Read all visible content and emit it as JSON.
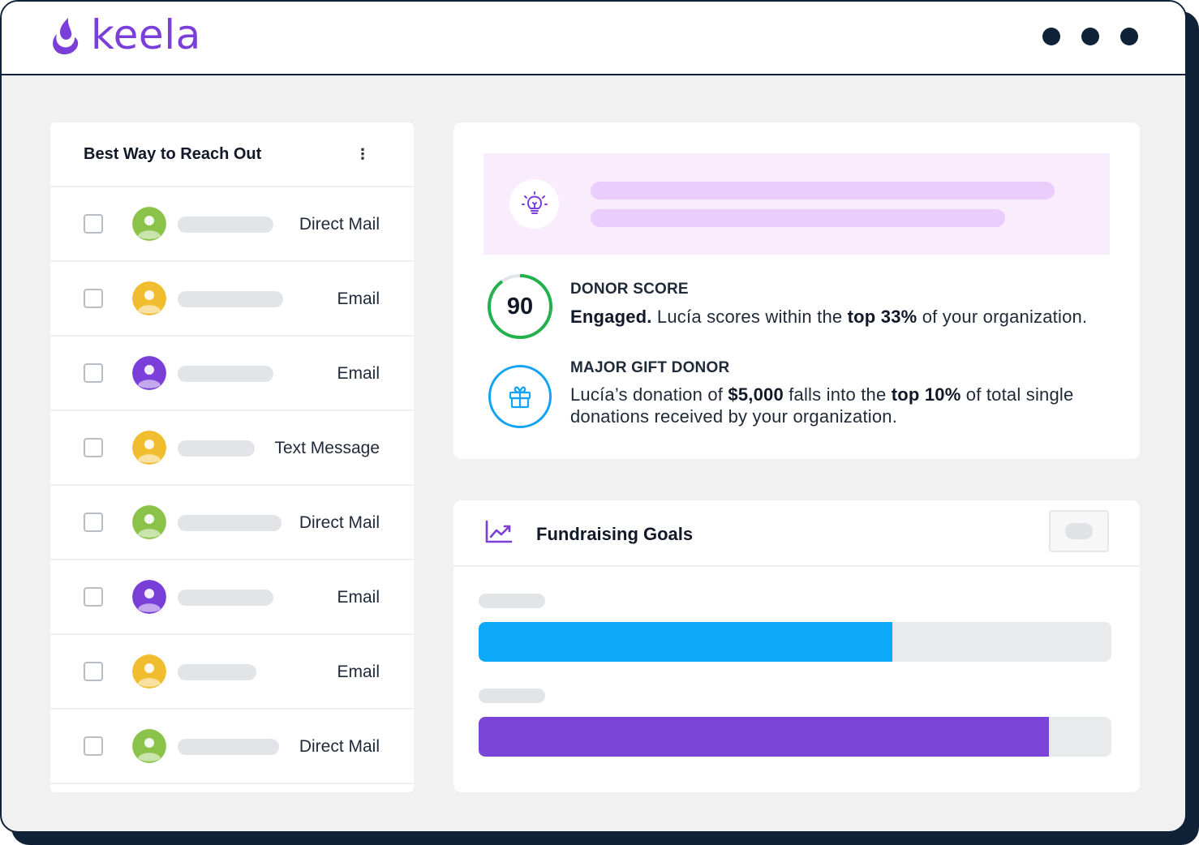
{
  "app": {
    "logo_text": "keela",
    "brand_color": "#7b3fd9",
    "menu_dots_icon": "window-dots-icon"
  },
  "contacts_panel": {
    "title": "Best Way to Reach Out",
    "menu_icon": "vertical-ellipsis-icon",
    "rows": [
      {
        "channel": "Direct Mail",
        "avatar_color": "#8bc34a"
      },
      {
        "channel": "Email",
        "avatar_color": "#f0bd2f"
      },
      {
        "channel": "Email",
        "avatar_color": "#7b3fd9"
      },
      {
        "channel": "Text Message",
        "avatar_color": "#f0bd2f"
      },
      {
        "channel": "Direct Mail",
        "avatar_color": "#8bc34a"
      },
      {
        "channel": "Email",
        "avatar_color": "#7b3fd9"
      },
      {
        "channel": "Email",
        "avatar_color": "#f0bd2f"
      },
      {
        "channel": "Direct Mail",
        "avatar_color": "#8bc34a"
      }
    ]
  },
  "donor": {
    "insight_icon": "lightbulb-icon",
    "score": {
      "value": "90",
      "fraction": 0.9,
      "ring_color": "#22b14c",
      "label": "DONOR SCORE",
      "status": "Engaged.",
      "text_1": " Lucía scores within the ",
      "highlight": "top 33%",
      "text_2": " of your organization."
    },
    "major_gift": {
      "icon": "gift-icon",
      "ring_color": "#13a3f2",
      "label": "MAJOR GIFT DONOR",
      "text_1": "Lucía’s donation of ",
      "amount": "$5,000",
      "text_2": " falls into the ",
      "highlight": "top 10%",
      "text_3": " of total single donations received by your organization."
    }
  },
  "goals": {
    "title": "Fundraising Goals",
    "icon": "trending-up-chart-icon",
    "bars": [
      {
        "progress": 0.654,
        "color": "#0ba9f8"
      },
      {
        "progress": 0.901,
        "color": "#7a44d6"
      }
    ]
  }
}
